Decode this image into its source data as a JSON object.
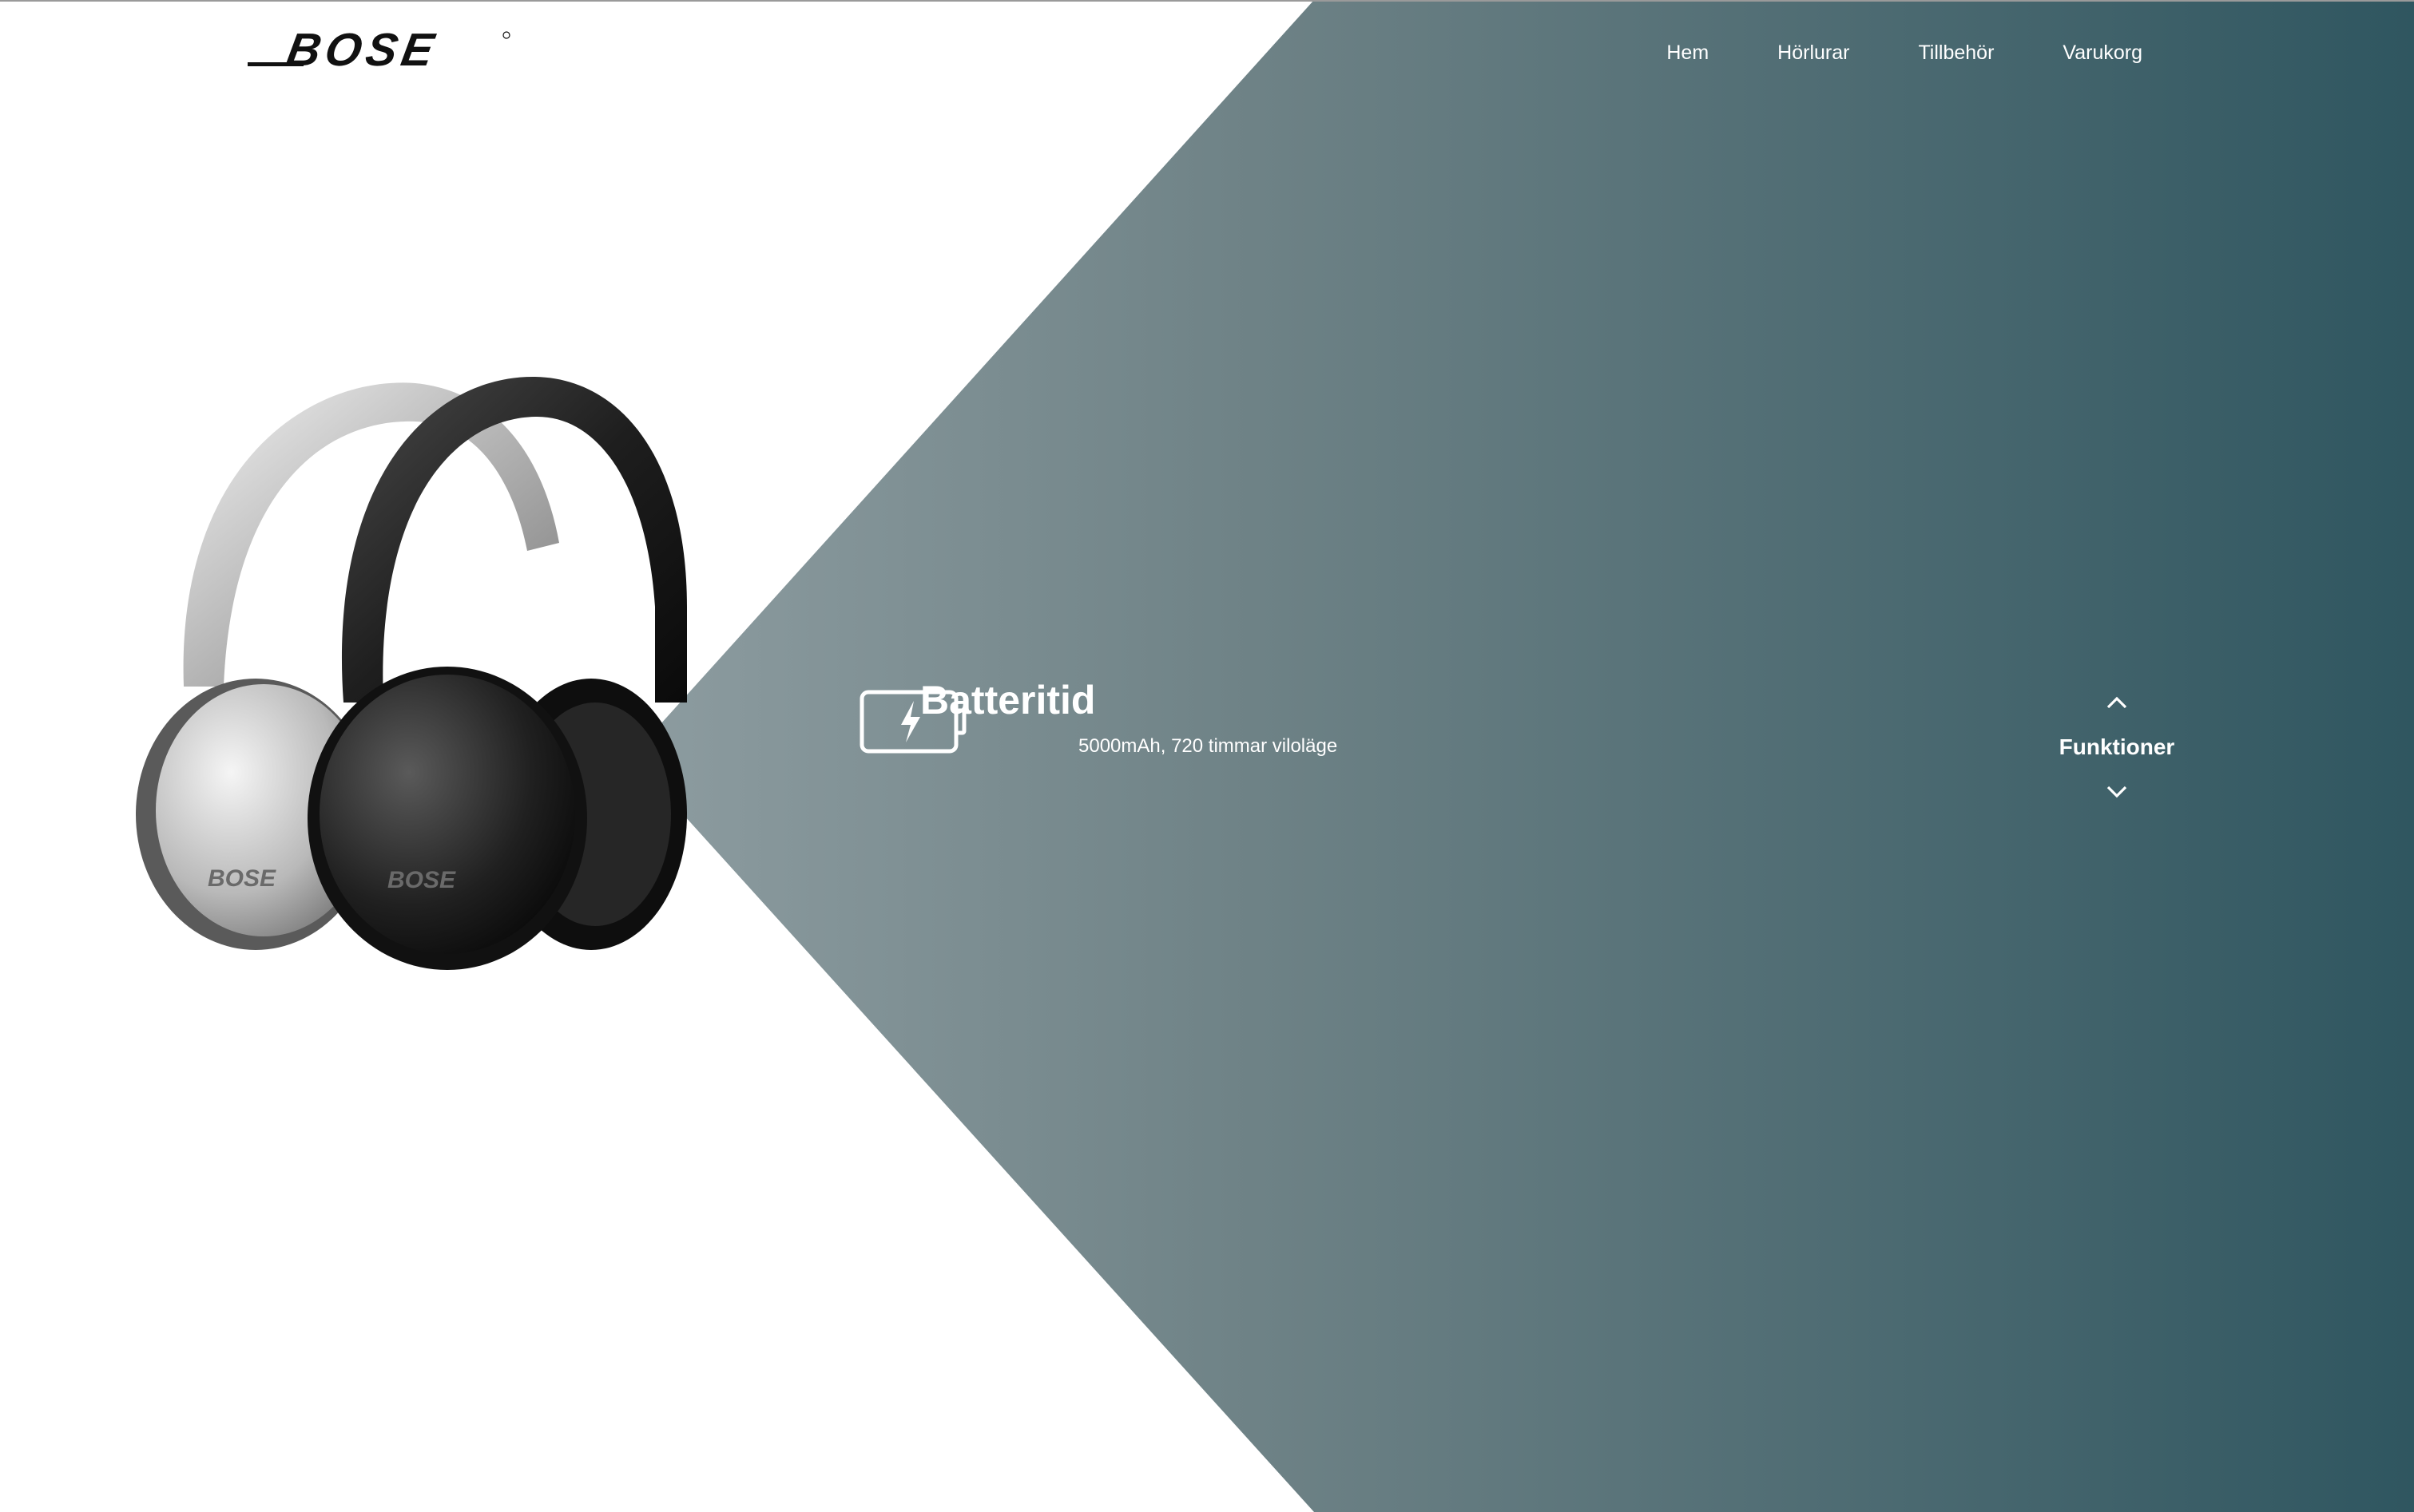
{
  "brand": {
    "logo_text": "BOSE"
  },
  "nav": {
    "items": [
      {
        "label": "Hem"
      },
      {
        "label": "Hörlurar"
      },
      {
        "label": "Tillbehör"
      },
      {
        "label": "Varukorg"
      }
    ]
  },
  "hero": {
    "image_icon": "headphones-image"
  },
  "feature": {
    "icon": "battery-charging-icon",
    "title": "Batteritid",
    "subtitle": "5000mAh, 720 timmar viloläge"
  },
  "feature_switcher": {
    "label": "Funktioner",
    "up_icon": "chevron-up-icon",
    "down_icon": "chevron-down-icon"
  },
  "colors": {
    "panel_light": "#8a9a9e",
    "panel_dark": "#2f5660",
    "text_on_panel": "#ffffff",
    "logo": "#111111"
  }
}
